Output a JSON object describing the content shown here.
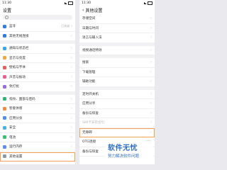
{
  "left": {
    "time": "11:30",
    "title": "设置",
    "groups": [
      [
        {
          "label": "蓝牙",
          "value": "已关闭",
          "color": "#2f7de1"
        },
        {
          "label": "其他无线连接",
          "color": "#2f7de1"
        }
      ],
      [
        {
          "label": "通知与状态栏",
          "color": "#3aa6e8"
        },
        {
          "label": "显示与亮度",
          "color": "#f4a83a"
        },
        {
          "label": "壁纸与字体",
          "color": "#e85b5b"
        },
        {
          "label": "声音与振动",
          "color": "#ef5c8a"
        },
        {
          "label": "免打扰",
          "color": "#9b6be0"
        }
      ],
      [
        {
          "label": "指纹、面部与密码",
          "color": "#2fb672"
        },
        {
          "label": "智能体感",
          "color": "#f28a3c"
        },
        {
          "label": "应用分身",
          "color": "#4a8ef0"
        },
        {
          "label": "安全",
          "color": "#46b3e6"
        },
        {
          "label": "电池",
          "color": "#36c26b"
        },
        {
          "label": "运行内存",
          "color": "#5d8ef2"
        },
        {
          "label": "其他设置",
          "color": "#8d98a6",
          "highlight": true
        }
      ]
    ]
  },
  "right": {
    "time": "11:30",
    "title": "其他设置",
    "groups": [
      [
        {
          "label": "存储空间"
        },
        {
          "label": "日期与时间"
        },
        {
          "label": "语言与输入法"
        }
      ],
      [
        {
          "label": "视频通话特效"
        }
      ],
      [
        {
          "label": "搜索"
        },
        {
          "label": "下载管理"
        },
        {
          "label": "辅助功能"
        }
      ],
      [
        {
          "label": "定时开关机"
        },
        {
          "label": "应用分享"
        },
        {
          "label": "备份与恢复"
        },
        {
          "label": "SIM卡安装指引",
          "disabled": true
        },
        {
          "label": "无障碍",
          "highlight": true
        },
        {
          "label": "OTG连接",
          "toggle": true
        },
        {
          "label": "备份与恢复"
        }
      ]
    ]
  },
  "watermark": {
    "title": "软件无忧",
    "subtitle": "努力解决软件问题"
  }
}
